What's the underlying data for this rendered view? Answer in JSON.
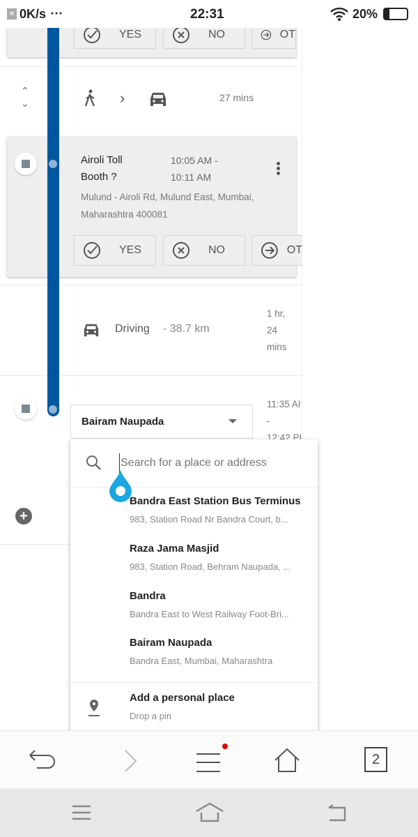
{
  "status_bar": {
    "speed": "0K/s",
    "dots": "⋯",
    "time": "22:31",
    "battery": "20%"
  },
  "colors": {
    "timeline": "#0057a0",
    "pin": "#1aa7df",
    "notification_dot": "#e00000"
  },
  "card_top": {
    "buttons": [
      {
        "label": "YES",
        "icon": "check-circle-icon"
      },
      {
        "label": "NO",
        "icon": "x-circle-icon"
      },
      {
        "label": "OT",
        "icon": "arrow-circle-icon"
      }
    ]
  },
  "walk_row": {
    "duration": "27 mins"
  },
  "stop_card": {
    "title_line1": "Airoli Toll",
    "title_line2": "Booth ?",
    "time_line1": "10:05 AM -",
    "time_line2": "10:11 AM",
    "address_line1": "Mulund - Airoli Rd, Mulund East, Mumbai,",
    "address_line2": "Maharashtra 400081",
    "buttons": [
      {
        "label": "YES"
      },
      {
        "label": "NO"
      },
      {
        "label": "OT"
      }
    ]
  },
  "driving_row": {
    "mode": "Driving",
    "distance": "- 38.7 km",
    "duration_line1": "1 hr,",
    "duration_line2": "24",
    "duration_line3": "mins"
  },
  "last_stop": {
    "selected": "Bairam Naupada",
    "time_line1": "11:35 AI",
    "time_line2": "-",
    "time_line3": "12:42 PI"
  },
  "search": {
    "placeholder": "Search for a place or address",
    "suggestions": [
      {
        "title": "Bandra East Station Bus Terminus",
        "subtitle": "983, Station Road Nr Bandra Court, b..."
      },
      {
        "title": "Raza Jama Masjid",
        "subtitle": "983, Station Road, Behram Naupada, ..."
      },
      {
        "title": "Bandra",
        "subtitle": "Bandra East to West Railway Foot-Bri..."
      },
      {
        "title": "Bairam Naupada",
        "subtitle": "Bandra East, Mumbai, Maharashtra"
      }
    ],
    "personal": {
      "title": "Add a personal place",
      "subtitle": "Drop a pin"
    }
  },
  "browser_nav": {
    "tab_count": "2"
  }
}
